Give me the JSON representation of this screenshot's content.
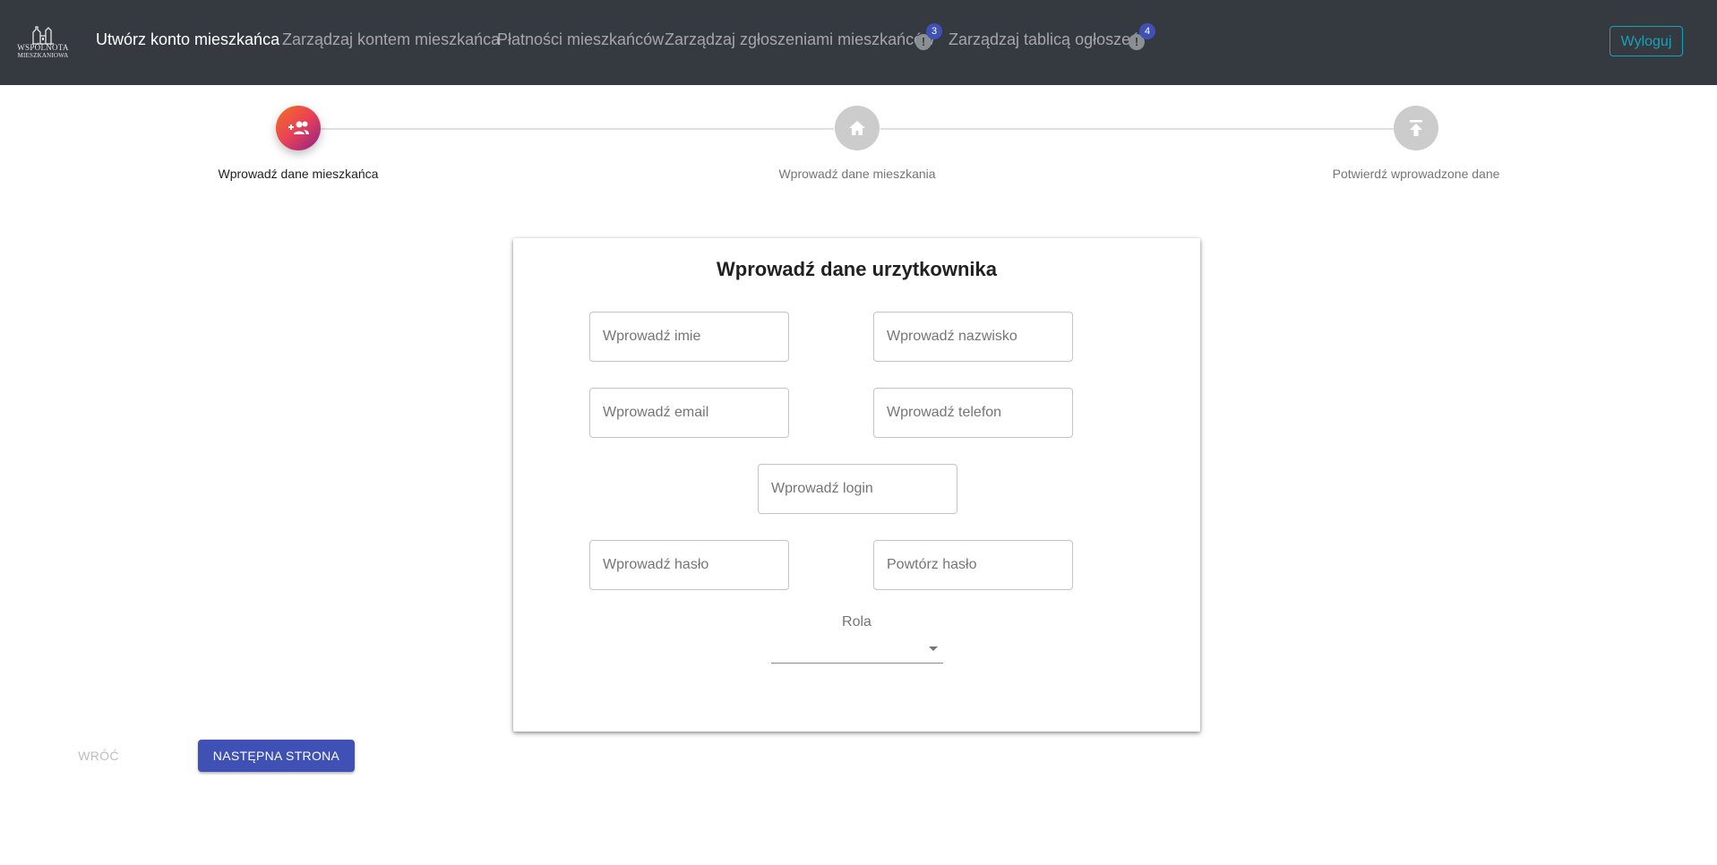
{
  "navbar": {
    "logo": {
      "line1": "WSPÓLNOTA",
      "line2": "MIESZKANIOWA"
    },
    "links": [
      {
        "label": "Utwórz konto mieszkańca",
        "active": true
      },
      {
        "label": "Zarządzaj kontem mieszkańca",
        "active": false
      },
      {
        "label": "Płatności mieszkańców",
        "active": false
      },
      {
        "label": "Zarządzaj zgłoszeniami mieszkańców",
        "active": false,
        "badge_count": "3",
        "alert_icon": "!"
      },
      {
        "label": "Zarządzaj tablicą ogłoszeń",
        "active": false,
        "badge_count": "4",
        "alert_icon": "!"
      }
    ],
    "logout_label": "Wyloguj"
  },
  "stepper": {
    "steps": [
      {
        "label": "Wprowadź dane mieszkańca",
        "icon": "group-add-icon",
        "active": true
      },
      {
        "label": "Wprowadź dane mieszkania",
        "icon": "home-icon",
        "active": false
      },
      {
        "label": "Potwierdź wprowadzone dane",
        "icon": "publish-icon",
        "active": false
      }
    ]
  },
  "form": {
    "title": "Wprowadź dane urzytkownika",
    "first_name": {
      "placeholder": "Wprowadź imie",
      "value": ""
    },
    "last_name": {
      "placeholder": "Wprowadź nazwisko",
      "value": ""
    },
    "email": {
      "placeholder": "Wprowadź email",
      "value": ""
    },
    "phone": {
      "placeholder": "Wprowadź telefon",
      "value": ""
    },
    "login": {
      "placeholder": "Wprowadź login",
      "value": ""
    },
    "password": {
      "placeholder": "Wprowadź hasło",
      "value": ""
    },
    "password_repeat": {
      "placeholder": "Powtórz hasło",
      "value": ""
    },
    "role": {
      "label": "Rola",
      "selected": ""
    }
  },
  "actions": {
    "back_label": "WRÓĆ",
    "next_label": "NASTĘPNA STRONA"
  },
  "colors": {
    "navbar_bg": "#343a40",
    "accent": "#3f51b5",
    "logout_outline": "#17a2b8",
    "step_active_gradient": [
      "#f27121",
      "#e94057",
      "#8a2387"
    ],
    "step_inactive": "#cccccc"
  }
}
